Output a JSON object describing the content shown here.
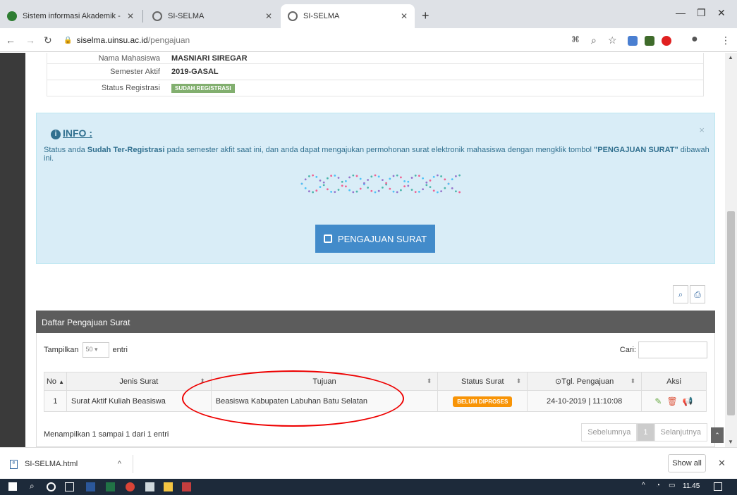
{
  "browser": {
    "tabs": [
      {
        "title": "Sistem informasi Akademik - Uni",
        "active": false
      },
      {
        "title": "SI-SELMA",
        "active": false
      },
      {
        "title": "SI-SELMA",
        "active": true
      }
    ],
    "new_tab_label": "+",
    "url_host": "siselma.uinsu.ac.id",
    "url_path": "/pengajuan"
  },
  "student": {
    "rows": [
      {
        "label": "Nama Mahasiswa",
        "value": "MASNIARI SIREGAR"
      },
      {
        "label": "Semester Aktif",
        "value": "2019-GASAL"
      },
      {
        "label": "Status Registrasi",
        "value": "SUDAH REGISTRASI"
      }
    ]
  },
  "info": {
    "title": "INFO :",
    "text_1": "Status anda ",
    "text_bold_1": "Sudah Ter-Registrasi",
    "text_2": " pada semester akfit saat ini, dan anda dapat mengajukan permohonan surat elektronik mahasiswa dengan mengklik tombol ",
    "text_bold_2": "\"PENGAJUAN SURAT\"",
    "text_3": " dibawah ini.",
    "close": "×",
    "button_label": "PENGAJUAN SURAT"
  },
  "table": {
    "title": "Daftar Pengajuan Surat",
    "length_prefix": "Tampilkan",
    "length_value": "50",
    "length_suffix": "entri",
    "search_label": "Cari:",
    "columns": [
      "No",
      "Jenis Surat",
      "Tujuan",
      "Status Surat",
      "Tgl. Pengajuan",
      "Aksi"
    ],
    "rows": [
      {
        "no": "1",
        "jenis": "Surat Aktif Kuliah Beasiswa",
        "tujuan": "Beasiswa Kabupaten Labuhan Batu Selatan",
        "status": "BELUM DIPROSES",
        "tanggal": "24-10-2019 | 11:10:08"
      }
    ],
    "info": "Menampilkan 1 sampai 1 dari 1 entri",
    "prev": "Sebelumnya",
    "page": "1",
    "next": "Selanjutnya"
  },
  "download_bar": {
    "file": "SI-SELMA.html",
    "show_all": "Show all"
  },
  "taskbar": {
    "time": "11.45"
  },
  "colors": {
    "accent_blue": "#428bca",
    "success_green": "#82af6f",
    "warning_orange": "#f89406",
    "alert_bg": "#d9edf7"
  }
}
